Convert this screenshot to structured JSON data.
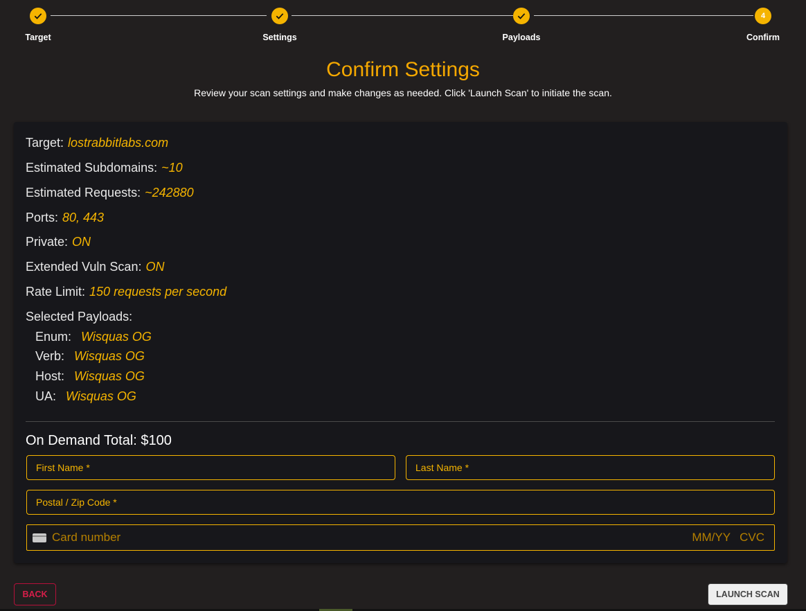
{
  "stepper": {
    "steps": [
      {
        "label": "Target",
        "status": "complete",
        "icon": "check-icon"
      },
      {
        "label": "Settings",
        "status": "complete",
        "icon": "check-icon"
      },
      {
        "label": "Payloads",
        "status": "complete",
        "icon": "check-icon"
      },
      {
        "label": "Confirm",
        "status": "active",
        "number": "4"
      }
    ]
  },
  "header": {
    "title": "Confirm Settings",
    "subtitle": "Review your scan settings and make changes as needed. Click 'Launch Scan' to initiate the scan."
  },
  "summary": {
    "target": {
      "label": "Target:",
      "value": "lostrabbitlabs.com"
    },
    "subdomains": {
      "label": "Estimated Subdomains:",
      "value": "~10"
    },
    "requests": {
      "label": "Estimated Requests:",
      "value": "~242880"
    },
    "ports": {
      "label": "Ports:",
      "value": "80, 443"
    },
    "private": {
      "label": "Private:",
      "value": "ON"
    },
    "vuln": {
      "label": "Extended Vuln Scan:",
      "value": "ON"
    },
    "rate": {
      "label": "Rate Limit:",
      "value": "150 requests per second"
    },
    "payloads_label": "Selected Payloads:",
    "payloads": [
      {
        "label": "Enum:",
        "value": "Wisquas OG"
      },
      {
        "label": "Verb:",
        "value": "Wisquas OG"
      },
      {
        "label": "Host:",
        "value": "Wisquas OG"
      },
      {
        "label": "UA:",
        "value": "Wisquas OG"
      }
    ]
  },
  "payment": {
    "total": "On Demand Total: $100",
    "first_name": "First Name *",
    "last_name": "Last Name *",
    "postal": "Postal / Zip Code *",
    "card_number": "Card number",
    "expiry": "MM/YY",
    "cvc": "CVC"
  },
  "actions": {
    "back": "BACK",
    "launch": "LAUNCH SCAN"
  },
  "colors": {
    "accent": "#f5b400",
    "background": "#221f1f",
    "card": "#17171b",
    "back": "#d81e4a"
  }
}
